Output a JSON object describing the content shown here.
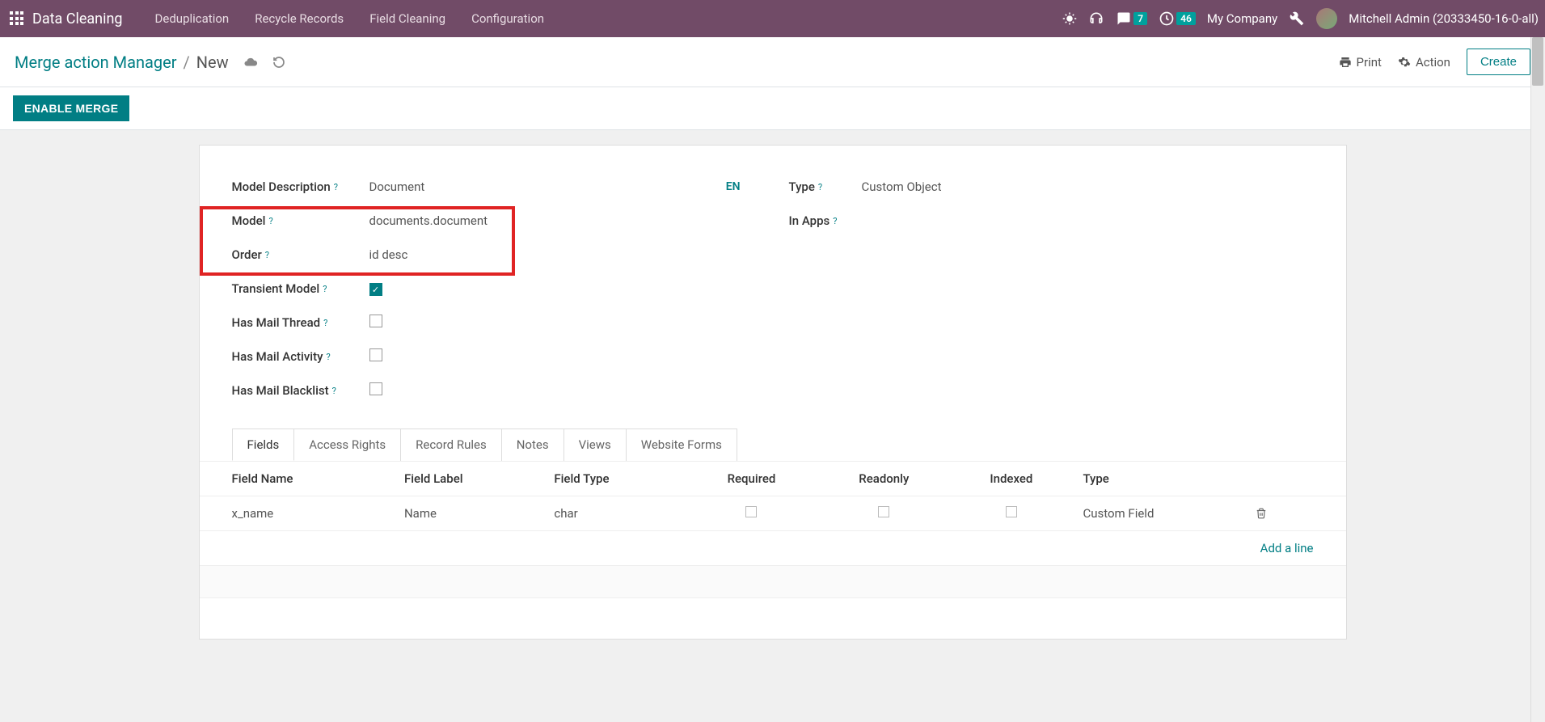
{
  "navbar": {
    "brand": "Data Cleaning",
    "items": [
      "Deduplication",
      "Recycle Records",
      "Field Cleaning",
      "Configuration"
    ],
    "messages_badge": "7",
    "activities_badge": "46",
    "company": "My Company",
    "user": "Mitchell Admin (20333450-16-0-all)"
  },
  "breadcrumb": {
    "parent": "Merge action Manager",
    "current": "New"
  },
  "actions": {
    "print": "Print",
    "action": "Action",
    "create": "Create"
  },
  "status_button": "ENABLE MERGE",
  "form": {
    "left": {
      "model_description": {
        "label": "Model Description",
        "value": "Document"
      },
      "model": {
        "label": "Model",
        "value": "documents.document"
      },
      "order": {
        "label": "Order",
        "value": "id desc"
      },
      "transient": {
        "label": "Transient Model",
        "checked": true
      },
      "mail_thread": {
        "label": "Has Mail Thread",
        "checked": false
      },
      "mail_activity": {
        "label": "Has Mail Activity",
        "checked": false
      },
      "mail_blacklist": {
        "label": "Has Mail Blacklist",
        "checked": false
      }
    },
    "lang": "EN",
    "right": {
      "type": {
        "label": "Type",
        "value": "Custom Object"
      },
      "in_apps": {
        "label": "In Apps",
        "value": ""
      }
    }
  },
  "tabs": [
    "Fields",
    "Access Rights",
    "Record Rules",
    "Notes",
    "Views",
    "Website Forms"
  ],
  "table": {
    "headers": [
      "Field Name",
      "Field Label",
      "Field Type",
      "Required",
      "Readonly",
      "Indexed",
      "Type"
    ],
    "rows": [
      {
        "name": "x_name",
        "label": "Name",
        "ftype": "char",
        "required": false,
        "readonly": false,
        "indexed": false,
        "type": "Custom Field"
      }
    ],
    "add_line": "Add a line"
  }
}
